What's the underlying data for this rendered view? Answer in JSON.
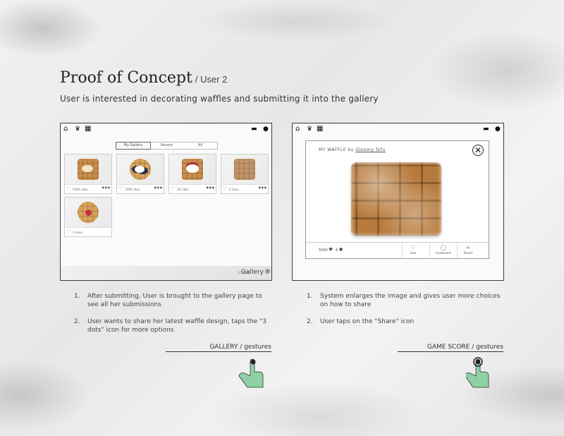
{
  "header": {
    "title": "Proof of Concept",
    "user_tag": "/ User 2",
    "subtitle": "User is interested in decorating waffles and submitting it into the gallery"
  },
  "left_device": {
    "tabs": [
      "My Gallery",
      "Recent",
      "All"
    ],
    "active_tab": "My Gallery",
    "cards": [
      {
        "likes": "5000 Likes",
        "style": "banana"
      },
      {
        "likes": "1000 Likes",
        "style": "blueberry"
      },
      {
        "likes": "50 Likes",
        "style": "berry"
      },
      {
        "likes": "5 Likes",
        "style": "sugar"
      },
      {
        "likes": "5 Likes",
        "style": "strawberry"
      }
    ],
    "footer_user": "USER",
    "footer_title": "Gallery"
  },
  "right_device": {
    "modal_title": "MY WAFFLE",
    "by": "by",
    "author": "Gloomy Tofu",
    "likes_count": "5000",
    "comments_count": "6",
    "actions": [
      "Like",
      "Comment",
      "Share"
    ]
  },
  "left_notes": [
    {
      "num": "1.",
      "text": "After submitting, User is brought to the gallery page to see all her submissions"
    },
    {
      "num": "2.",
      "text": "User wants to share her latest waffle design, taps the \"3 dots\" icon for more options"
    }
  ],
  "right_notes": [
    {
      "num": "1.",
      "text": "System enlarges the image and gives user more choices on how to share"
    },
    {
      "num": "2.",
      "text": "User taps on the \"Share\" icon"
    }
  ],
  "gestures": {
    "left_label": "GALLERY / gestures",
    "right_label": "GAME SCORE  / gestures"
  },
  "colors": {
    "hand_green": "#8fd0a6",
    "device_border": "#3a3a3a"
  }
}
